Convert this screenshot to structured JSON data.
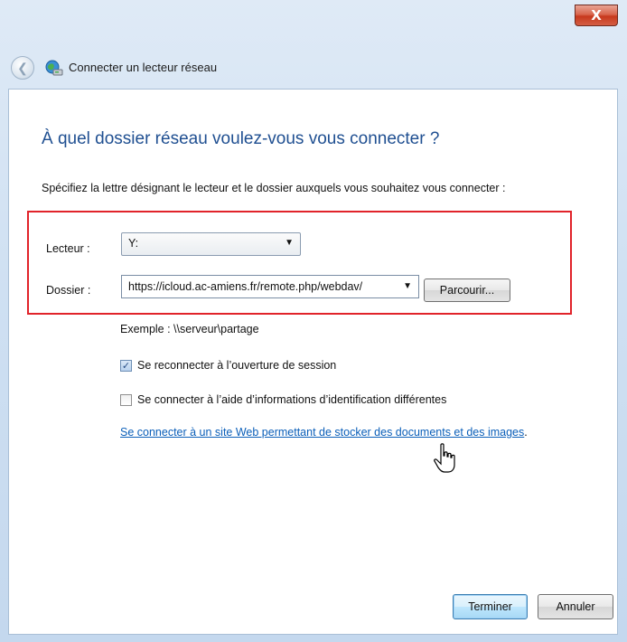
{
  "window": {
    "title": "Connecter un lecteur réseau",
    "close_label": "X"
  },
  "main": {
    "heading": "À quel dossier réseau voulez-vous vous connecter ?",
    "instructions": "Spécifiez la lettre désignant le lecteur et le dossier auxquels vous souhaitez vous connecter :",
    "drive_label": "Lecteur :",
    "drive_value": "Y:",
    "folder_label": "Dossier :",
    "folder_value": "https://icloud.ac-amiens.fr/remote.php/webdav/",
    "browse_label": "Parcourir...",
    "example": "Exemple : \\\\serveur\\partage",
    "reconnect_label": "Se reconnecter à l’ouverture de session",
    "reconnect_checked": true,
    "other_credentials_label": "Se connecter à l’aide d’informations d’identification différentes",
    "other_credentials_checked": false,
    "link_text": "Se connecter à un site Web permettant de stocker des documents et des images",
    "link_suffix": "."
  },
  "footer": {
    "finish_label": "Terminer",
    "cancel_label": "Annuler"
  },
  "icons": {
    "back": "back-arrow-icon",
    "network": "network-drive-icon",
    "dropdown": "chevron-down-icon",
    "cursor": "hand-pointer-icon"
  },
  "colors": {
    "heading": "#1f4f91",
    "link": "#0b5fb9",
    "highlight_box": "#e1232a",
    "close_button": "#c7391d"
  }
}
